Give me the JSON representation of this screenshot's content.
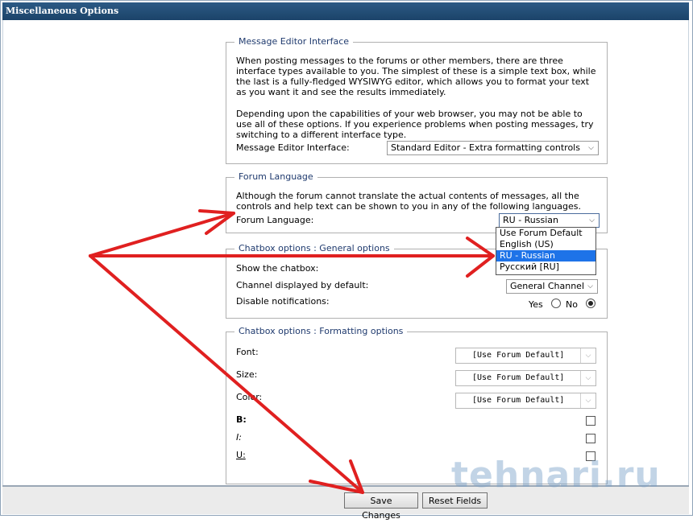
{
  "window": {
    "title": "Miscellaneous Options"
  },
  "editor": {
    "legend": "Message Editor Interface",
    "desc1": [
      "When posting messages to the forums or other members, there are three",
      "interface types available to you. The simplest of these is a simple text box, while",
      "the last is a fully-fledged WYSIWYG editor, which allows you to format your text",
      "as you want it and see the results immediately."
    ],
    "desc2": [
      "Depending upon the capabilities of your web browser, you may not be able to",
      "use all of these options. If you experience problems when posting messages, try",
      "switching to a different interface type."
    ],
    "label": "Message Editor Interface:",
    "value": "Standard Editor - Extra formatting controls"
  },
  "language": {
    "legend": "Forum Language",
    "desc": [
      "Although the forum cannot translate the actual contents of messages, all the",
      "controls and help text can be shown to you in any of the following languages."
    ],
    "label": "Forum Language:",
    "value": "RU - Russian",
    "options": [
      "Use Forum Default",
      "English (US)",
      "RU - Russian",
      "Русский [RU]"
    ],
    "selected_index": 2
  },
  "chatbox_general": {
    "legend": "Chatbox options : General options",
    "show_label": "Show the chatbox:",
    "channel_label": "Channel displayed by default:",
    "channel_value": "General Channel",
    "notif_label": "Disable notifications:",
    "yes": "Yes",
    "no": "No",
    "notif_selected": "No"
  },
  "chatbox_format": {
    "legend": "Chatbox options : Formatting options",
    "font_label": "Font:",
    "size_label": "Size:",
    "color_label": "Color:",
    "default_value": "[Use Forum Default]",
    "bold_label": "B",
    "italic_label": "I",
    "underline_label": "U"
  },
  "buttons": {
    "save": "Save Changes",
    "reset": "Reset Fields"
  },
  "watermark": "tehnari.ru",
  "colors": {
    "title_bar": "#1b4369",
    "legend": "#1f3a6e",
    "highlight": "#1e73e8",
    "arrow": "#e02020"
  }
}
